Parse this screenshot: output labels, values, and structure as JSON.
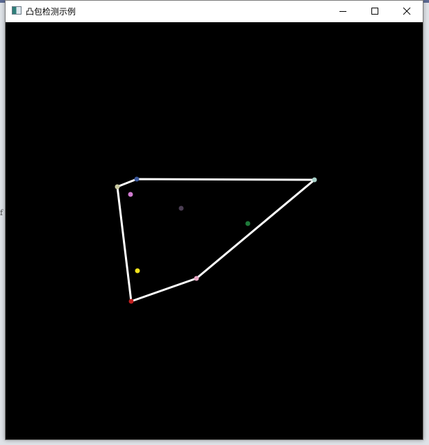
{
  "window": {
    "title": "凸包检测示例",
    "icon": "app-icon"
  },
  "controls": {
    "minimize_icon": "minimize-icon",
    "maximize_icon": "maximize-icon",
    "close_icon": "close-icon"
  },
  "background_text": "f",
  "canvas": {
    "background_color": "#000000",
    "hull_color": "#ffffff",
    "hull_vertices": [
      "p-left-top",
      "p-top-blue",
      "p-top-right",
      "p-mid-pink",
      "p-bottom-red"
    ],
    "points": [
      {
        "id": "p-left-top",
        "color": "#c8c8a0"
      },
      {
        "id": "p-top-blue",
        "color": "#3d5a9e"
      },
      {
        "id": "p-top-right",
        "color": "#a8d0c8"
      },
      {
        "id": "p-inside-magenta",
        "color": "#d07bd0"
      },
      {
        "id": "p-inside-gray",
        "color": "#4a3d52"
      },
      {
        "id": "p-inside-green",
        "color": "#1e7a3a"
      },
      {
        "id": "p-inside-yellow",
        "color": "#f2e21c"
      },
      {
        "id": "p-mid-pink",
        "color": "#e7a7c4"
      },
      {
        "id": "p-bottom-red",
        "color": "#c02020"
      }
    ]
  }
}
